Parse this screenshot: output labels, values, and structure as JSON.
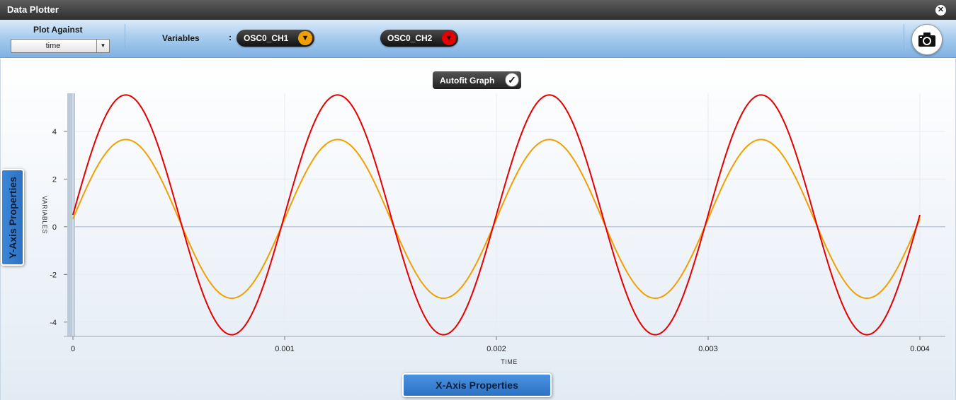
{
  "window": {
    "title": "Data Plotter",
    "close_icon": "close-icon"
  },
  "toolbar": {
    "plot_against_label": "Plot Against",
    "plot_against_value": "time",
    "variables_label": "Variables",
    "colon": ":",
    "variables": [
      {
        "label": "OSC0_CH1",
        "color": "#f0a000",
        "indicator": "▼"
      },
      {
        "label": "OSC0_CH2",
        "color": "#e60000",
        "indicator": "▼"
      }
    ],
    "snapshot_icon": "camera-icon"
  },
  "autofit": {
    "label": "Autofit Graph",
    "checked": true,
    "check_glyph": "✓"
  },
  "y_axis_tab": {
    "label": "Y-Axis Properties"
  },
  "x_axis_tab": {
    "label": "X-Axis Properties"
  },
  "chart_data": {
    "type": "line",
    "xlabel": "TIME",
    "ylabel": "VARIABLES",
    "xlim": [
      0,
      0.004
    ],
    "ylim": [
      -4.6,
      5.6
    ],
    "xticks": [
      0,
      0.001,
      0.002,
      0.003,
      0.004
    ],
    "xtick_labels": [
      "0",
      "0.001",
      "0.002",
      "0.003",
      "0.004"
    ],
    "yticks": [
      -4,
      -2,
      0,
      2,
      4
    ],
    "ytick_labels": [
      "-4",
      "-2",
      "0",
      "2",
      "4"
    ],
    "grid": true,
    "series": [
      {
        "name": "OSC0_CH1",
        "color": "#f0a000",
        "waveform": "sine",
        "amplitude": 3.33,
        "offset": 0.33,
        "frequency_hz": 1000,
        "start_value": 0.33,
        "end_value": 0.33
      },
      {
        "name": "OSC0_CH2",
        "color": "#e60000",
        "waveform": "sine",
        "amplitude": 5.03,
        "offset": 0.5,
        "frequency_hz": 1000,
        "start_value": 0.5,
        "end_value": 0.5
      }
    ]
  }
}
